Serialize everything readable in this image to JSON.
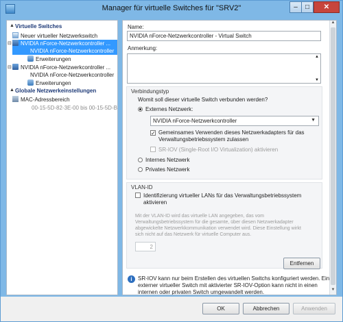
{
  "window": {
    "title": "Manager für virtuelle Switches für \"SRV2\""
  },
  "tree": {
    "virtual_switches_header": "Virtuelle Switches",
    "new_switch": "Neuer virtueller Netzwerkswitch",
    "switch1_name": "NVIDIA nForce-Netzwerkcontroller ...",
    "switch1_sub": "NVIDIA nForce-Netzwerkcontroller",
    "switch1_extensions": "Erweiterungen",
    "switch2_name": "NVIDIA nForce-Netzwerkcontroller ...",
    "switch2_sub": "NVIDIA nForce-Netzwerkcontroller",
    "switch2_extensions": "Erweiterungen",
    "global_header": "Globale Netzwerkeinstellungen",
    "mac_label": "MAC-Adressbereich",
    "mac_value": "00-15-5D-82-3E-00 bis 00-15-5D-B..."
  },
  "form": {
    "name_label": "Name:",
    "name_value": "NVIDIA nForce-Netzwerkcontroller - Virtual Switch",
    "notes_label": "Anmerkung:",
    "conn_group_title": "Verbindungstyp",
    "conn_question": "Womit soll dieser virtuelle Switch verbunden werden?",
    "external_label": "Externes Netzwerk:",
    "external_select_value": "NVIDIA nForce-Netzwerkcontroller",
    "share_label_line1": "Gemeinsames Verwenden dieses Netzwerkadapters für das",
    "share_label_line2": "Verwaltungsbetriebssystem zulassen",
    "sriov_label": "SR-IOV (Single-Root I/O Virtualization) aktivieren",
    "internal_label": "Internes Netzwerk",
    "private_label": "Privates Netzwerk",
    "vlan_group_title": "VLAN-ID",
    "vlan_check_line1": "Identifizierung virtueller LANs für das Verwaltungsbetriebssystem",
    "vlan_check_line2": "aktivieren",
    "vlan_desc_line1": "Mit der VLAN-ID wird das virtuelle LAN angegeben, das vom",
    "vlan_desc_line2": "Verwaltungsbetriebssystem für die gesamte, über diesen Netzwerkadapter",
    "vlan_desc_line3": "abgewickelte Netzwerkkommunikation verwendet wird. Diese Einstellung wirkt",
    "vlan_desc_line4": "sich nicht auf das Netzwerk für virtuelle Computer aus.",
    "vlan_value": "2",
    "remove_button": "Entfernen",
    "info_line1": "SR-IOV kann nur beim Erstellen des virtuellen Switchs konfiguriert werden. Ein",
    "info_line2": "externer virtueller Switch mit aktivierter SR-IOV-Option kann nicht in einen",
    "info_line3": "internen oder privaten Switch umgewandelt werden."
  },
  "footer": {
    "ok": "OK",
    "cancel": "Abbrechen",
    "apply": "Anwenden"
  },
  "state": {
    "external_selected": true,
    "share_checked": true,
    "sriov_checked": false,
    "vlan_checked": false
  },
  "colors": {
    "selection": "#3399ff",
    "header_text": "#1f3b78",
    "window_frame": "#7fb8e6"
  },
  "icons": [
    "app-icon",
    "switch-icon",
    "extension-icon",
    "mac-icon",
    "info-icon"
  ]
}
